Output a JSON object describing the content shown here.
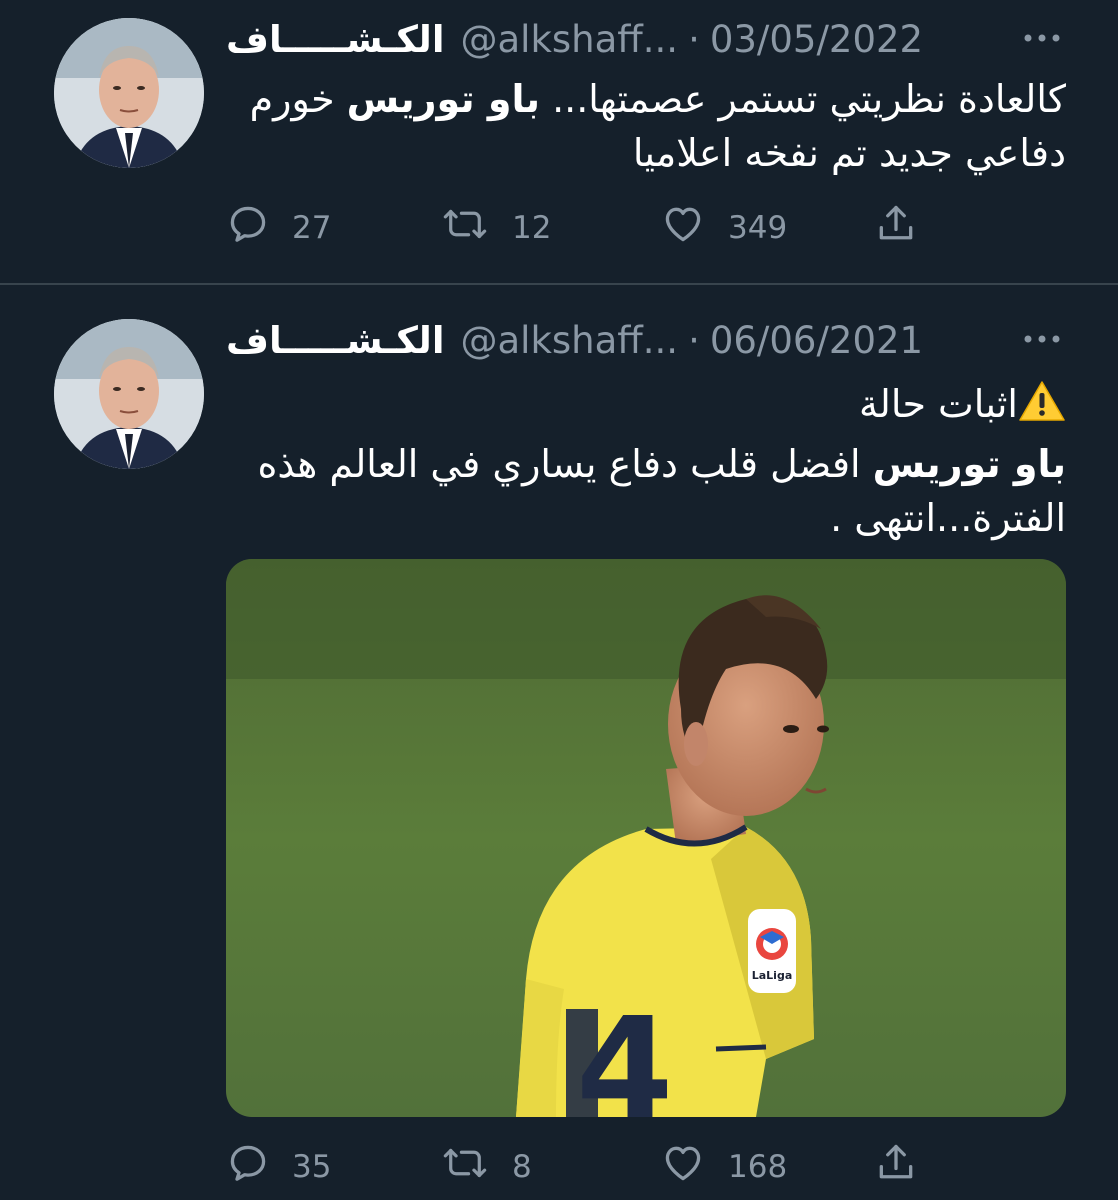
{
  "tweets": [
    {
      "author_name": "الكـشـــــاف",
      "handle": "@alkshaff...",
      "separator": "·",
      "date": "03/05/2022",
      "text_part1": "كالعادة نظريتي تستمر عصمتها... ",
      "text_bold": "باو توريس",
      "text_part2": " خورم دفاعي جديد تم نفخه اعلاميا",
      "replies": "27",
      "retweets": "12",
      "likes": "349"
    },
    {
      "author_name": "الكـشـــــاف",
      "handle": "@alkshaff...",
      "separator": "·",
      "date": "06/06/2021",
      "text_line1": "اثبات حالة",
      "text_bold": "باو توريس",
      "text_part2": " افضل قلب دفاع يساري في العالم هذه الفترة...انتهى .",
      "media_logo_text": "LaLiga",
      "jersey_number": "4",
      "replies": "35",
      "retweets": "8",
      "likes": "168"
    }
  ],
  "icons": {
    "more": "more-horizontal-icon",
    "reply": "reply-bubble-icon",
    "retweet": "retweet-icon",
    "like": "heart-icon",
    "share": "share-icon",
    "warning": "warning-icon"
  },
  "colors": {
    "background": "#15202b",
    "text": "#ffffff",
    "secondary": "#8b98a5",
    "divider": "#38444d",
    "warning": "#ffcc33"
  }
}
